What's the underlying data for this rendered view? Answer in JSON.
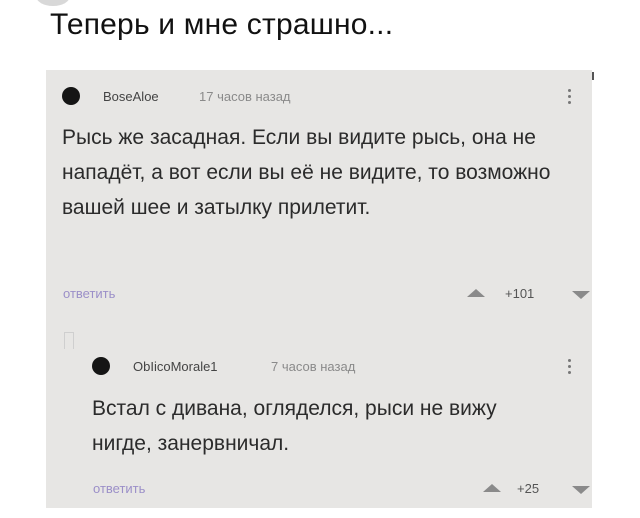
{
  "post": {
    "title": "Теперь и мне страшно..."
  },
  "comments": [
    {
      "username": "BoseAloe",
      "time": "17 часов назад",
      "text": "Рысь же засадная. Если вы видите рысь, она не нападёт, а вот если вы её не видите, то возможно вашей шее и затылку прилетит.",
      "reply_label": "ответить",
      "score": "+101",
      "avatar_icon": "avatar-circle",
      "menu_icon": "vertical-dots"
    },
    {
      "username": "ObIicoMorale1",
      "time": "7 часов назад",
      "text": "Встал с дивана, огляделся, рыси не вижу нигде, занервничал.",
      "reply_label": "ответить",
      "score": "+25",
      "avatar_icon": "avatar-circle",
      "menu_icon": "vertical-dots"
    }
  ],
  "colors": {
    "card_bg": "#e7e6e4",
    "reply_link": "#9b8fc8",
    "vote_arrow": "#8a8a8a"
  }
}
